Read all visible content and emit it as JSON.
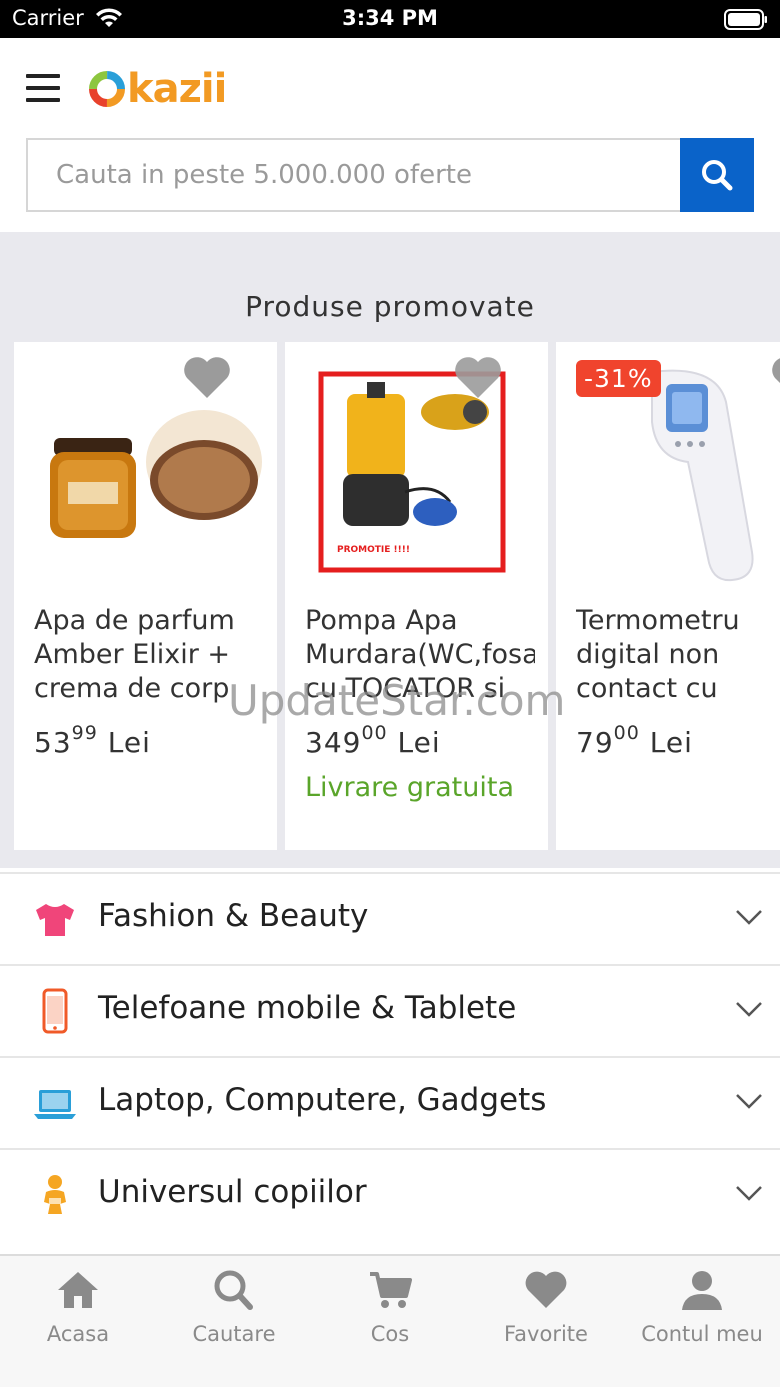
{
  "status_bar": {
    "carrier": "Carrier",
    "time": "3:34 PM"
  },
  "header": {
    "logo_text": "kazii",
    "search_placeholder": "Cauta in peste 5.000.000 oferte"
  },
  "promo": {
    "title": "Produse promovate",
    "products": [
      {
        "title": "Apa de parfum Amber Elixir + crema de corp",
        "price_int": "53",
        "price_dec": "99",
        "currency": "Lei",
        "shipping": "",
        "discount": "",
        "image": "perfume-product-image"
      },
      {
        "title": "Pompa Apa Murdara(WC,fosa cu TOCATOR si",
        "price_int": "349",
        "price_dec": "00",
        "currency": "Lei",
        "shipping": "Livrare gratuita",
        "discount": "",
        "image": "water-pump-product-image",
        "image_caption": "PROMOTIE !!!!"
      },
      {
        "title": "Termometru digital non contact cu",
        "price_int": "79",
        "price_dec": "00",
        "currency": "Lei",
        "shipping": "",
        "discount": "-31%",
        "image": "thermometer-product-image"
      }
    ]
  },
  "watermark": "UpdateStar.com",
  "categories": [
    {
      "label": "Fashion & Beauty",
      "icon": "tshirt-icon",
      "color": "#f0457a"
    },
    {
      "label": "Telefoane mobile & Tablete",
      "icon": "phone-icon",
      "color": "#f05a28"
    },
    {
      "label": "Laptop, Computere, Gadgets",
      "icon": "laptop-icon",
      "color": "#2a9fd8"
    },
    {
      "label": "Universul copiilor",
      "icon": "baby-icon",
      "color": "#f5a623"
    }
  ],
  "tabbar": [
    {
      "label": "Acasa",
      "icon": "home-icon"
    },
    {
      "label": "Cautare",
      "icon": "search-icon"
    },
    {
      "label": "Cos",
      "icon": "cart-icon"
    },
    {
      "label": "Favorite",
      "icon": "heart-icon"
    },
    {
      "label": "Contul meu",
      "icon": "user-icon"
    }
  ],
  "colors": {
    "accent_blue": "#0a63c9",
    "logo_orange": "#f29a23",
    "discount_red": "#f0442d",
    "shipping_green": "#5aa52a"
  }
}
